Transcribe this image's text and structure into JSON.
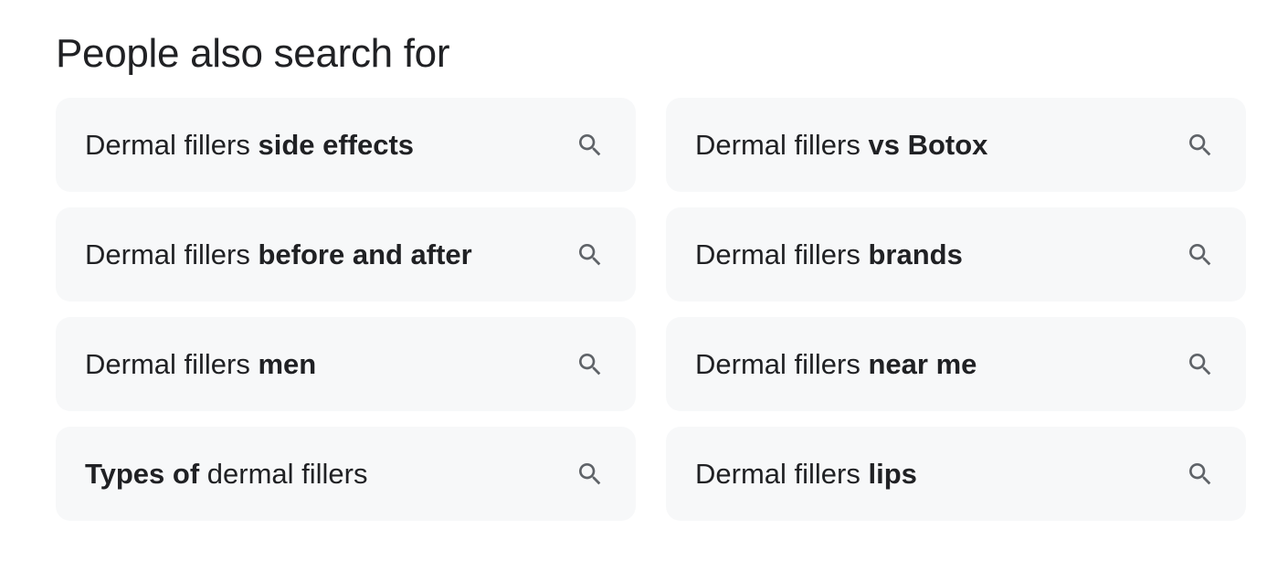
{
  "section": {
    "title": "People also search for"
  },
  "colors": {
    "chip_background": "#f7f8f9",
    "text": "#202124",
    "icon": "#5f6368"
  },
  "suggestions": [
    {
      "plain": "Dermal fillers ",
      "bold": "side effects",
      "icon": "search-icon"
    },
    {
      "plain": "Dermal fillers ",
      "bold": "vs Botox",
      "icon": "search-icon"
    },
    {
      "plain": "Dermal fillers ",
      "bold": "before and after",
      "icon": "search-icon"
    },
    {
      "plain": "Dermal fillers ",
      "bold": "brands",
      "icon": "search-icon"
    },
    {
      "plain": "Dermal fillers ",
      "bold": "men",
      "icon": "search-icon"
    },
    {
      "plain": "Dermal fillers ",
      "bold": "near me",
      "icon": "search-icon"
    },
    {
      "bold_prefix": "Types of",
      "plain_suffix": " dermal fillers",
      "icon": "search-icon"
    },
    {
      "plain": "Dermal fillers ",
      "bold": "lips",
      "icon": "search-icon"
    }
  ]
}
